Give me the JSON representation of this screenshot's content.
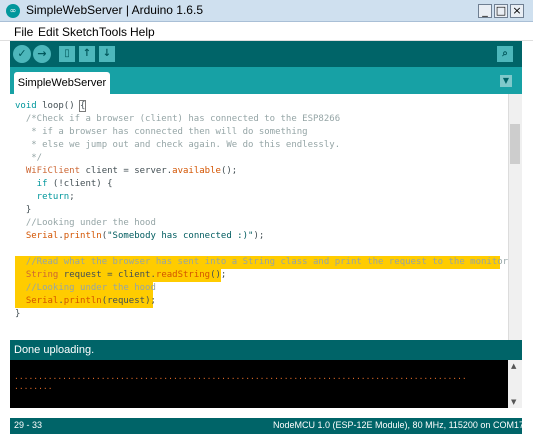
{
  "window": {
    "title": "SimpleWebServer | Arduino 1.6.5",
    "icon": "arduino-logo-icon",
    "controls": [
      "minimize",
      "maximize",
      "close"
    ]
  },
  "menu": {
    "file": "File",
    "edit": "Edit",
    "sketch": "Sketch",
    "tools": "Tools",
    "help": "Help"
  },
  "toolbar": {
    "icons": [
      "verify-icon",
      "upload-icon",
      "new-icon",
      "open-icon",
      "save-icon",
      "serial-monitor-icon"
    ]
  },
  "tabs": [
    {
      "label": "SimpleWebServer"
    }
  ],
  "editor": {
    "lines": [
      {
        "kw": "void",
        "name": " loop() ",
        "brace": "{"
      },
      {
        "text": "  /*Check if a browser (client) has connected to the ESP8266"
      },
      {
        "text": "   * if a browser has connected then will do something"
      },
      {
        "text": "   * else we jump out and check again. We do this endlessly."
      },
      {
        "text": "   */"
      },
      {
        "type": "  WiFiClient",
        "mid": " client = server.",
        "fn": "available",
        "end": "();"
      },
      {
        "kw": "    if",
        "rest": " (!client) {"
      },
      {
        "kw": "    return",
        "rest": ";"
      },
      {
        "text": "  }"
      },
      {
        "text": "  //Looking under the hood"
      },
      {
        "type": "  Serial",
        "mid": ".",
        "fn": "println",
        "open": "(",
        "str": "\"Somebody has connected :)\"",
        "end": ");"
      },
      {
        "text": ""
      },
      {
        "text": "  //Read what the browser has sent into a String class and print the request to the monitor"
      },
      {
        "type": "  String",
        "mid": " request = client.",
        "fn": "readString",
        "end": "();"
      },
      {
        "text": "  //Looking under the hood"
      },
      {
        "type": "  Serial",
        "mid": ".",
        "fn": "println",
        "end": "(request);"
      },
      {
        "text": "}"
      }
    ]
  },
  "status": {
    "message": "Done uploading."
  },
  "console": {
    "lines": [
      "..............................................................................................",
      "........"
    ]
  },
  "footer": {
    "line_range": "29 - 33",
    "board": "NodeMCU 1.0 (ESP-12E Module), 80 MHz, 115200 on COM17"
  },
  "colors": {
    "toolbar": "#006468",
    "tabstrip": "#17a1a5",
    "highlight": "#ffcc00",
    "keyword": "#00979c",
    "function": "#d35400",
    "comment": "#95a5a6",
    "console_text": "#e26c2a"
  }
}
